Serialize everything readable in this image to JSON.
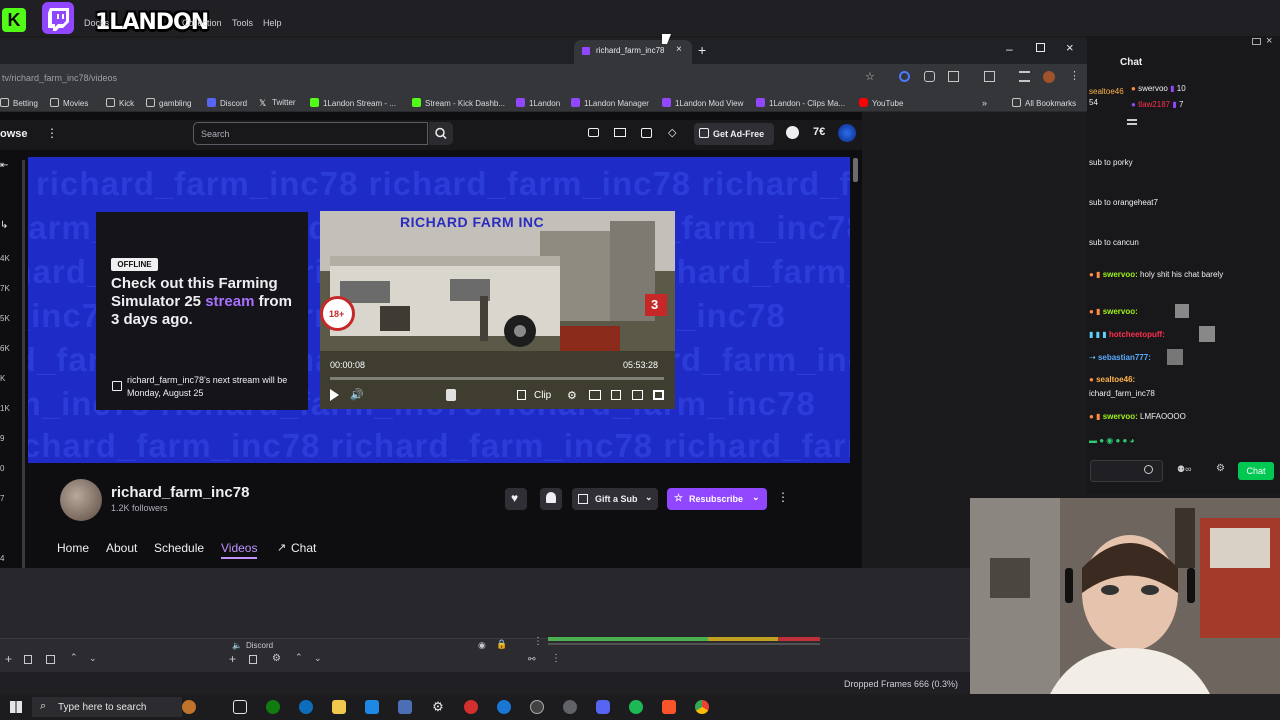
{
  "obs": {
    "menu": [
      "Docks",
      "Collection",
      "Tools",
      "Help"
    ],
    "overlay_logo_text": "1LANDON",
    "logo_k": "K",
    "audio_source": "Discord",
    "dropped_frames": "Dropped Frames 666 (0.3%)"
  },
  "browser": {
    "tab_title": "richard_farm_inc78",
    "address": "tv/richard_farm_inc78/videos",
    "bookmarks": [
      {
        "label": "Betting",
        "icon": "folder-icon",
        "color": "#dcdcdf"
      },
      {
        "label": "Movies",
        "icon": "folder-icon",
        "color": "#dcdcdf"
      },
      {
        "label": "Kick",
        "icon": "folder-icon",
        "color": "#dcdcdf"
      },
      {
        "label": "gambling",
        "icon": "folder-icon",
        "color": "#dcdcdf"
      },
      {
        "label": "Discord",
        "icon": "discord-icon",
        "color": "#5865f2"
      },
      {
        "label": "Twitter",
        "icon": "x-icon",
        "color": "#ffffff"
      },
      {
        "label": "1Landon Stream - ...",
        "icon": "kick-icon",
        "color": "#53fc18"
      },
      {
        "label": "Stream - Kick Dashb...",
        "icon": "kick-icon",
        "color": "#53fc18"
      },
      {
        "label": "1Landon",
        "icon": "twitch-icon",
        "color": "#9146ff"
      },
      {
        "label": "1Landon Manager",
        "icon": "twitch-icon",
        "color": "#9146ff"
      },
      {
        "label": "1Landon Mod View",
        "icon": "twitch-icon",
        "color": "#9146ff"
      },
      {
        "label": "1Landon - Clips Ma...",
        "icon": "twitch-icon",
        "color": "#9146ff"
      },
      {
        "label": "YouTube",
        "icon": "youtube-icon",
        "color": "#ff0000"
      }
    ],
    "all_bookmarks": "All Bookmarks"
  },
  "twitch": {
    "browse": "owse",
    "search_placeholder": "Search",
    "get_ad_free": "Get Ad-Free",
    "watermark_text": "richard_farm_inc78",
    "offline_badge": "OFFLINE",
    "headline_pre": "Check out this Farming Simulator 25 ",
    "headline_link": "stream",
    "headline_post": " from 3 days ago.",
    "next_stream": "richard_farm_inc78's next stream will be Monday, August 25",
    "video": {
      "overlay_title": "RICHARD FARM INC",
      "time_current": "00:00:08",
      "time_total": "05:53:28",
      "clip_label": "Clip",
      "badge_18": "18+",
      "badge_giants": "3"
    },
    "channel": {
      "name": "richard_farm_inc78",
      "followers": "1.2K followers",
      "gift_label": "Gift a Sub",
      "resub_label": "Resubscribe"
    },
    "tabs": [
      "Home",
      "About",
      "Schedule",
      "Videos",
      "Chat"
    ],
    "sidebar_numbers": [
      "4K",
      "7K",
      "5K",
      "6K",
      "K",
      "1K",
      "9",
      "0",
      "7",
      "4"
    ],
    "brand_color": "#9146ff"
  },
  "chat": {
    "title": "Chat",
    "top_users": [
      {
        "name": "sealtoe46",
        "value": "54"
      },
      {
        "name": "swervoo",
        "value": "10"
      },
      {
        "name": "tlaw2187",
        "value": "7"
      }
    ],
    "lines": [
      {
        "user": "",
        "text": "sub to porky",
        "color": "#efeff1"
      },
      {
        "user": "",
        "text": "sub to orangeheat7",
        "color": "#efeff1"
      },
      {
        "user": "",
        "text": "sub to cancun",
        "color": "#efeff1"
      },
      {
        "user": "swervoo:",
        "text": "holy shit his chat barely",
        "color": "#9ef01a"
      },
      {
        "user": "swervoo:",
        "text": "",
        "color": "#9ef01a"
      },
      {
        "user": "hotcheetopuff:",
        "text": "",
        "color": "#ff2e4c"
      },
      {
        "user": "sebastian777:",
        "text": "",
        "color": "#5aa9ff"
      },
      {
        "user": "sealtoe46:",
        "text": "",
        "color": "#ffb347"
      },
      {
        "user": "",
        "text": "ichard_farm_inc78",
        "color": "#efeff1"
      },
      {
        "user": "swervoo:",
        "text": "LMFAOOOO",
        "color": "#9ef01a"
      }
    ],
    "chat_button": "Chat",
    "accent": "#00c853"
  },
  "taskbar": {
    "search_placeholder": "Type here to search"
  }
}
